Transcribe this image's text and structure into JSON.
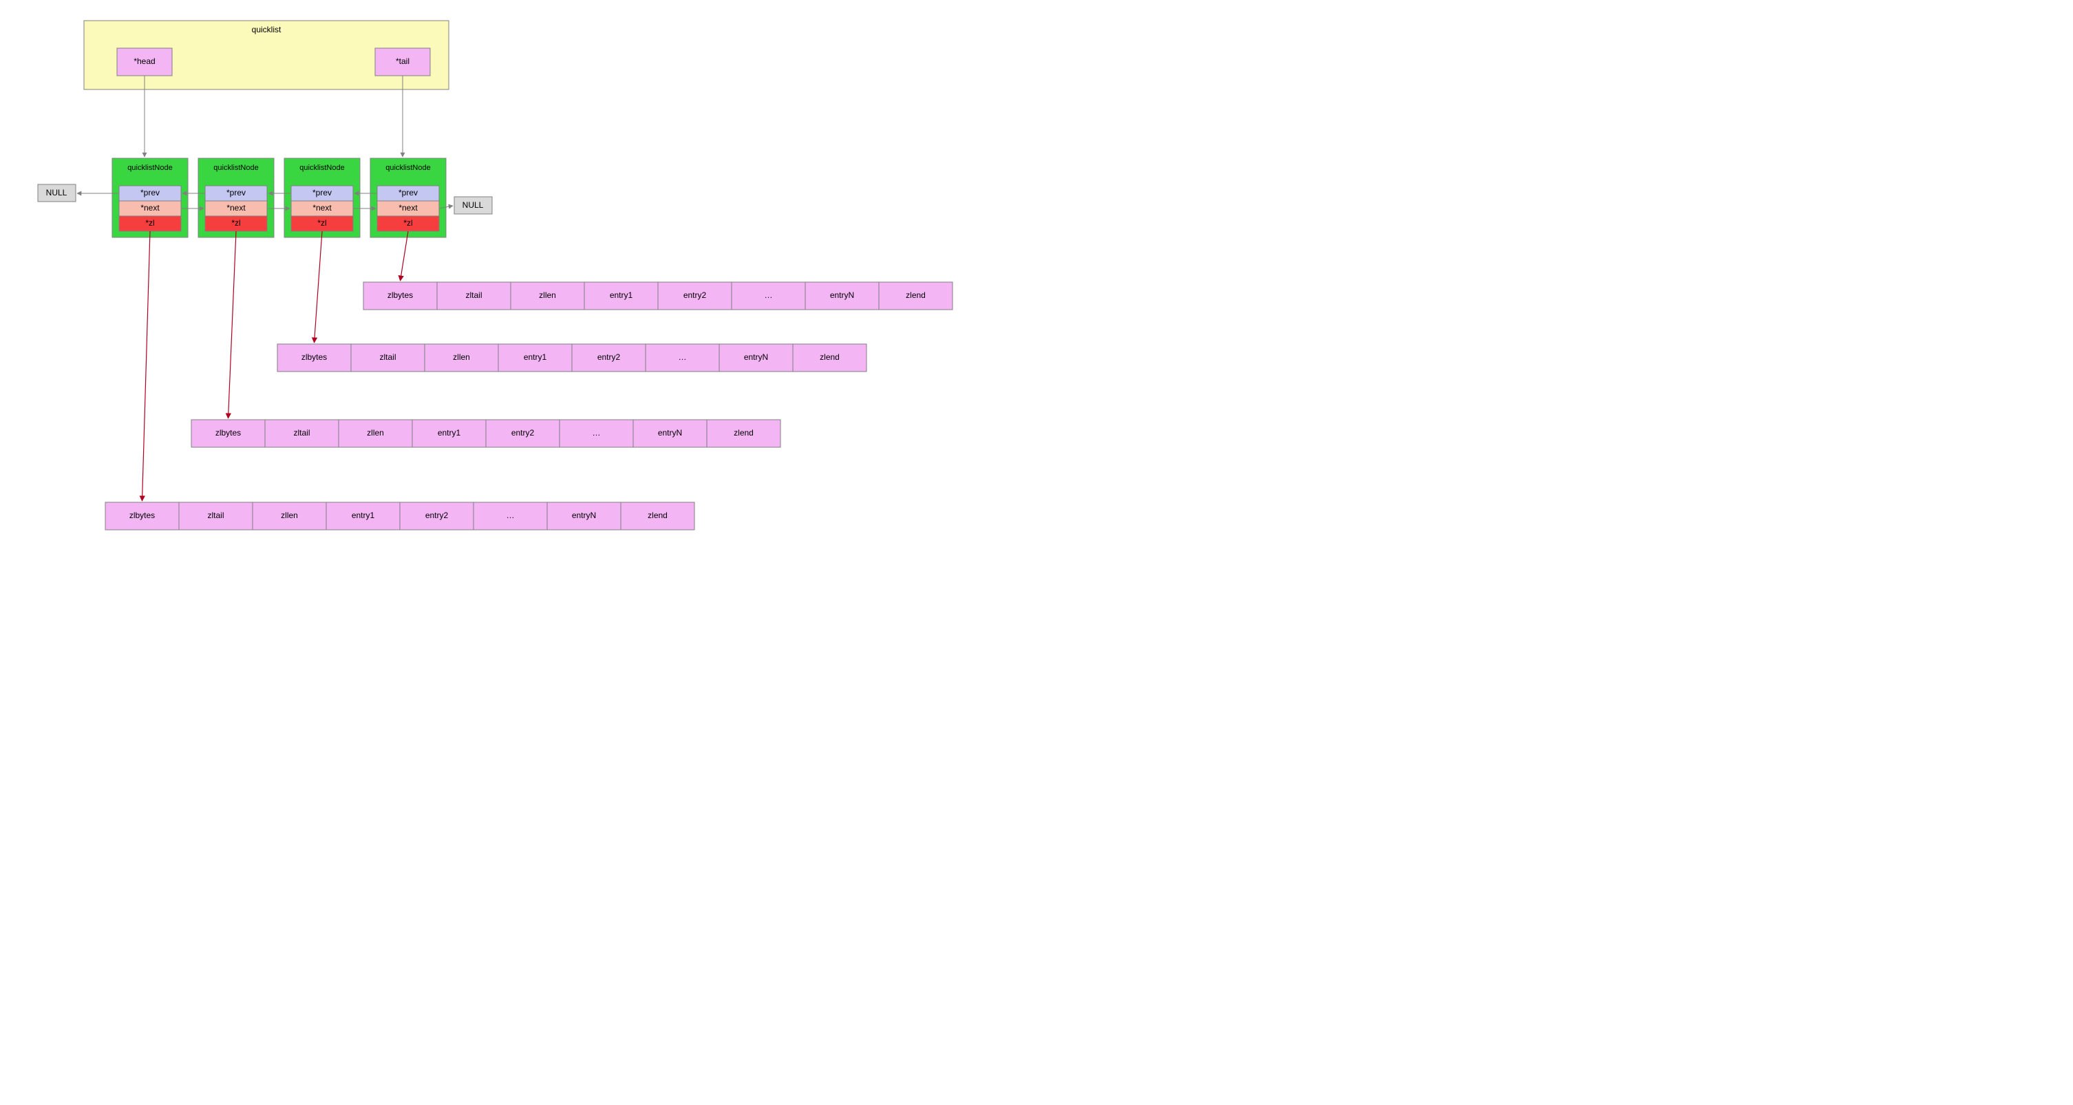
{
  "quicklist": {
    "title": "quicklist",
    "head": "*head",
    "tail": "*tail"
  },
  "null_left": "NULL",
  "null_right": "NULL",
  "node": {
    "title": "quicklistNode",
    "prev": "*prev",
    "next": "*next",
    "zl": "*zl"
  },
  "ziplist_cells": [
    "zlbytes",
    "zltail",
    "zllen",
    "entry1",
    "entry2",
    "…",
    "entryN",
    "zlend"
  ]
}
